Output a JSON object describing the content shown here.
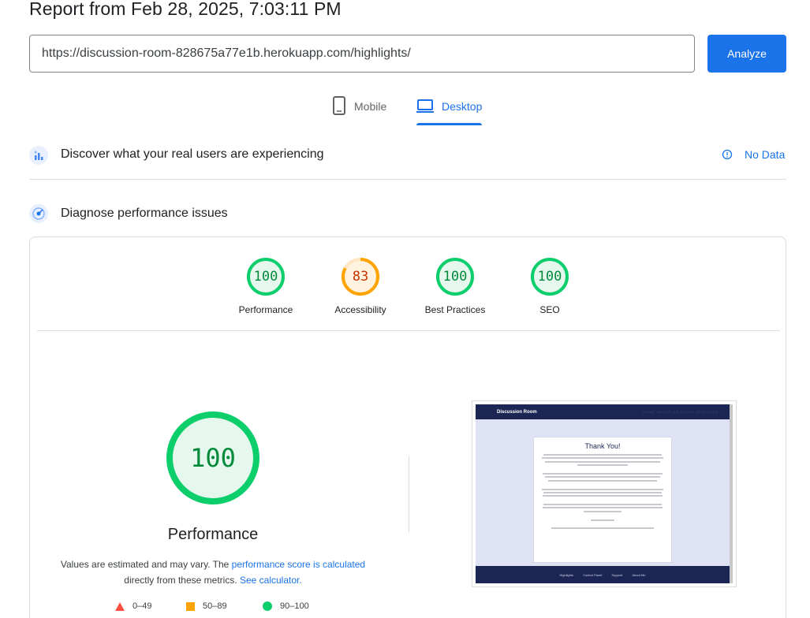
{
  "report": {
    "title": "Report from Feb 28, 2025, 7:03:11 PM",
    "url": "https://discussion-room-828675a77e1b.herokuapp.com/highlights/",
    "analyze_label": "Analyze"
  },
  "tabs": [
    {
      "label": "Mobile",
      "icon": "phone-icon",
      "active": false
    },
    {
      "label": "Desktop",
      "icon": "laptop-icon",
      "active": true
    }
  ],
  "crux": {
    "title": "Discover what your real users are experiencing",
    "status": "No Data",
    "status_icon": "info-icon"
  },
  "diagnose": {
    "title": "Diagnose performance issues",
    "scores": [
      {
        "label": "Performance",
        "value": "100",
        "color": "#0cce6b"
      },
      {
        "label": "Accessibility",
        "value": "83",
        "color": "#ffa400"
      },
      {
        "label": "Best Practices",
        "value": "100",
        "color": "#0cce6b"
      },
      {
        "label": "SEO",
        "value": "100",
        "color": "#0cce6b"
      }
    ],
    "main_score": "100",
    "main_label": "Performance",
    "note_prefix": "Values are estimated and may vary. The ",
    "note_link1": "performance score is calculated",
    "note_middle": "directly from these metrics. ",
    "note_link2": "See calculator.",
    "legend": [
      {
        "range": "0–49",
        "color": "#ff4e42",
        "shape": "triangle"
      },
      {
        "range": "50–89",
        "color": "#ffa400",
        "shape": "square"
      },
      {
        "range": "90–100",
        "color": "#0cce6b",
        "shape": "circle"
      }
    ]
  },
  "screenshot": {
    "brand": "Discussion Room",
    "nav_links": "HOME ABOUT US LOGIN REGISTER",
    "heading": "Thank You!",
    "footer_links": [
      "Highlights",
      "Control Panel",
      "Support",
      "About Me"
    ]
  }
}
